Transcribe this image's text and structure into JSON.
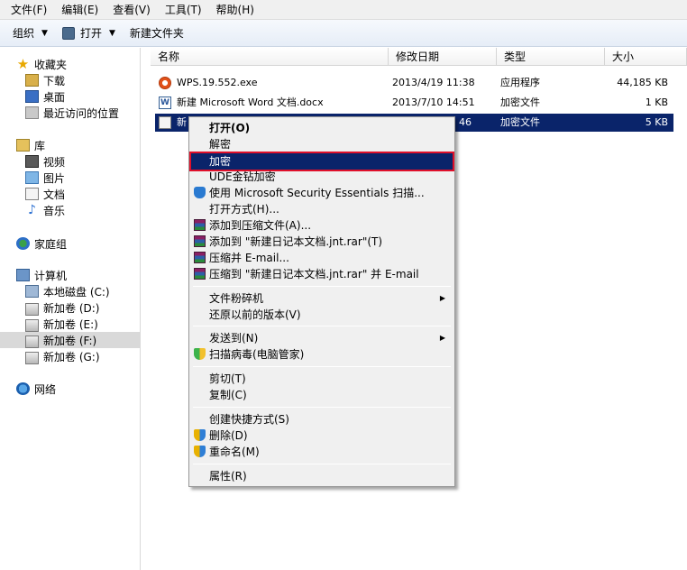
{
  "menubar": {
    "items": [
      "文件(F)",
      "编辑(E)",
      "查看(V)",
      "工具(T)",
      "帮助(H)"
    ]
  },
  "toolbar": {
    "organize": "组织",
    "open": "打开",
    "new_folder": "新建文件夹"
  },
  "nav": {
    "favorites": "收藏夹",
    "downloads": "下载",
    "desktop": "桌面",
    "recent": "最近访问的位置",
    "libraries": "库",
    "videos": "视频",
    "pictures": "图片",
    "documents": "文档",
    "music": "音乐",
    "homegroup": "家庭组",
    "computer": "计算机",
    "drives": [
      "本地磁盘 (C:)",
      "新加卷 (D:)",
      "新加卷 (E:)",
      "新加卷 (F:)",
      "新加卷 (G:)"
    ],
    "network": "网络"
  },
  "columns": {
    "name": "名称",
    "modified": "修改日期",
    "type": "类型",
    "size": "大小"
  },
  "files": [
    {
      "name": "WPS.19.552.exe",
      "modified": "2013/4/19 11:38",
      "type": "应用程序",
      "size": "44,185 KB"
    },
    {
      "name": "新建 Microsoft Word 文档.docx",
      "modified": "2013/7/10 14:51",
      "type": "加密文件",
      "size": "1 KB"
    },
    {
      "name": "新",
      "modified": "46",
      "type": "加密文件",
      "size": "5 KB"
    }
  ],
  "context_menu": {
    "open": "打开(O)",
    "decrypt": "解密",
    "encrypt": "加密",
    "ude": "UDE金钻加密",
    "mse_scan": "使用 Microsoft Security Essentials 扫描...",
    "open_with": "打开方式(H)...",
    "add_archive": "添加到压缩文件(A)...",
    "add_to_rar": "添加到 \"新建日记本文档.jnt.rar\"(T)",
    "compress_email": "压缩并 E-mail...",
    "compress_rar_email": "压缩到 \"新建日记本文档.jnt.rar\" 并 E-mail",
    "shredder": "文件粉碎机",
    "restore": "还原以前的版本(V)",
    "send_to": "发送到(N)",
    "scan_virus": "扫描病毒(电脑管家)",
    "cut": "剪切(T)",
    "copy": "复制(C)",
    "create_shortcut": "创建快捷方式(S)",
    "delete": "删除(D)",
    "rename": "重命名(M)",
    "properties": "属性(R)"
  }
}
